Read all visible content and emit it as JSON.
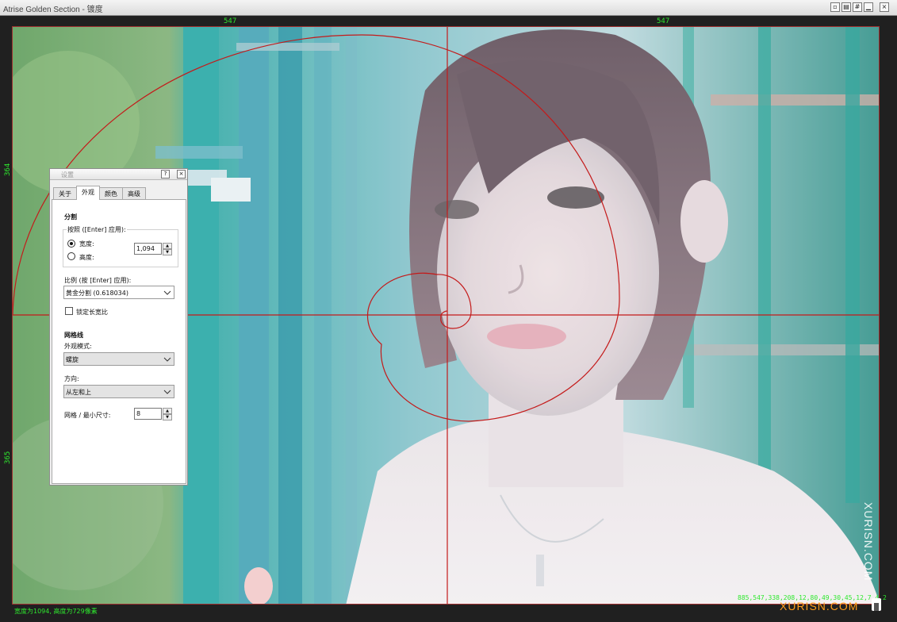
{
  "window": {
    "title": "Atrise Golden Section - 镀度",
    "controls": [
      "restore",
      "snap",
      "grid",
      "minimize",
      "close"
    ]
  },
  "rulers": {
    "top_left": "547",
    "top_right": "547",
    "left_top": "364",
    "left_bottom": "365"
  },
  "status": {
    "dimensions": "宽度为1094, 高度为729像素",
    "coords": "885,547,338,208,12,80,49,30,45,12,7,4,2"
  },
  "watermark": {
    "vertical": "XURISN.COM",
    "horizontal": "XURISN.COM"
  },
  "overlay": {
    "line_color": "#c41a1a",
    "accent_green": "#2ee82e"
  },
  "dialog": {
    "title": "设置",
    "help_icon": "?",
    "close_icon": "×",
    "tabs": [
      {
        "label": "关于",
        "active": false
      },
      {
        "label": "外观",
        "active": true
      },
      {
        "label": "颜色",
        "active": false
      },
      {
        "label": "高级",
        "active": false
      }
    ],
    "split": {
      "heading": "分割",
      "group_label": "按照 ([Enter] 应用):",
      "width_label": "宽度:",
      "height_label": "高度:",
      "selected": "width",
      "value": "1,094"
    },
    "ratio": {
      "label": "比例 (按 [Enter] 应用):",
      "value": "黄金分割 (0.618034)"
    },
    "lock_label": "锁定长宽比",
    "lock_checked": false,
    "grid": {
      "heading": "网格线",
      "style_label": "外观模式:",
      "style_value": "螺旋",
      "direction_label": "方向:",
      "direction_value": "从左和上",
      "min_size_label": "网格 / 最小尺寸:",
      "min_size_value": "8"
    }
  }
}
